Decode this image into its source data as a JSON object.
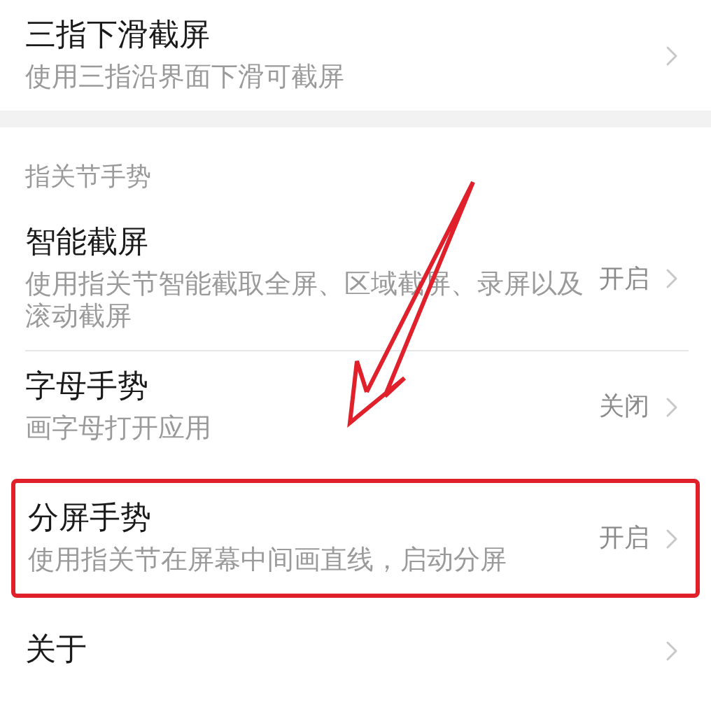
{
  "sections": [
    {
      "items": [
        {
          "title": "三指下滑截屏",
          "description": "使用三指沿界面下滑可截屏",
          "highlighted": false
        }
      ]
    },
    {
      "header": "指关节手势",
      "items": [
        {
          "title": "智能截屏",
          "description": "使用指关节智能截取全屏、区域截屏、录屏以及滚动截屏",
          "value": "开启",
          "highlighted": false
        },
        {
          "title": "字母手势",
          "description": "画字母打开应用",
          "value": "关闭",
          "highlighted": false
        },
        {
          "title": "分屏手势",
          "description": "使用指关节在屏幕中间画直线，启动分屏",
          "value": "开启",
          "highlighted": true
        },
        {
          "title": "关于",
          "highlighted": false
        }
      ]
    }
  ]
}
